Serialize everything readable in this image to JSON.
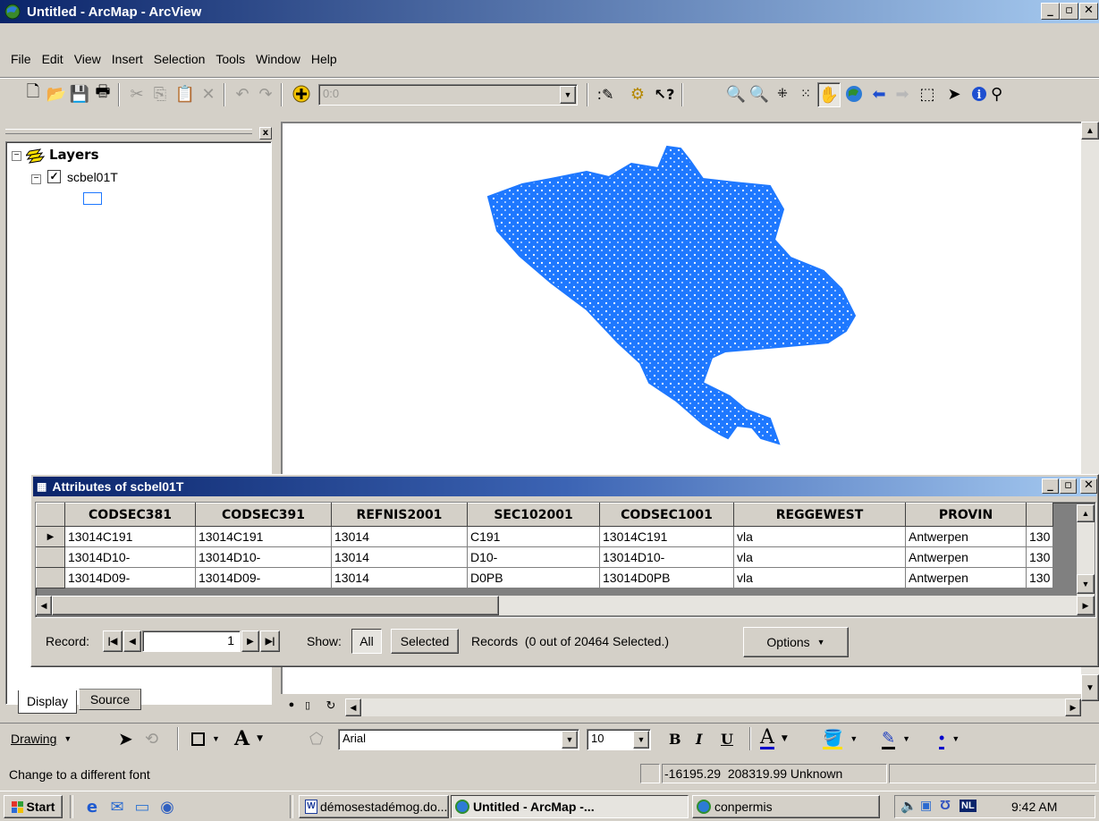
{
  "window": {
    "title": "Untitled - ArcMap - ArcView",
    "controls": [
      "_",
      "▫",
      "✕"
    ]
  },
  "menu": [
    "File",
    "Edit",
    "View",
    "Insert",
    "Selection",
    "Tools",
    "Window",
    "Help"
  ],
  "toolbar": {
    "scale_value": "0:0"
  },
  "toc": {
    "root_label": "Layers",
    "layer_label": "scbel01T",
    "tabs": [
      "Display",
      "Source"
    ]
  },
  "map": {
    "feature_color": "#1e78ff"
  },
  "attributes": {
    "title": "Attributes of scbel01T",
    "columns": [
      "CODSEC381",
      "CODSEC391",
      "REFNIS2001",
      "SEC102001",
      "CODSEC1001",
      "REGGEWEST",
      "PROVIN",
      ""
    ],
    "rows": [
      [
        "13014C191",
        "13014C191",
        "13014",
        "C191",
        "13014C191",
        "vla",
        "Antwerpen",
        "130"
      ],
      [
        "13014D10-",
        "13014D10-",
        "13014",
        "D10-",
        "13014D10-",
        "vla",
        "Antwerpen",
        "130"
      ],
      [
        "13014D09-",
        "13014D09-",
        "13014",
        "D0PB",
        "13014D0PB",
        "vla",
        "Antwerpen",
        "130"
      ]
    ],
    "record_label": "Record:",
    "record_value": "1",
    "show_label": "Show:",
    "all_label": "All",
    "selected_label": "Selected",
    "records_text": "Records  (0 out of 20464 Selected.)",
    "options_label": "Options"
  },
  "drawing": {
    "label": "Drawing",
    "font_name": "Arial",
    "font_size": "10",
    "bold": "B",
    "italic": "I",
    "underline": "U"
  },
  "status": {
    "message": "Change to a different font",
    "coords": "-16195.29  208319.99 Unknown"
  },
  "taskbar": {
    "start": "Start",
    "tasks": [
      "démosestadémog.do...",
      "Untitled - ArcMap -...",
      "conpermis"
    ],
    "lang": "NL",
    "time": "9:42 AM"
  }
}
